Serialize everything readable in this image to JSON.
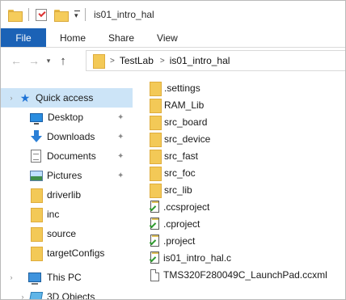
{
  "window": {
    "title": "is01_intro_hal"
  },
  "ribbon": {
    "tabs": [
      "File",
      "Home",
      "Share",
      "View"
    ]
  },
  "address": {
    "crumbs": [
      "TestLab",
      "is01_intro_hal"
    ]
  },
  "nav_pane": {
    "quick_access_label": "Quick access",
    "pinned": [
      {
        "label": "Desktop",
        "icon": "desktop-icon"
      },
      {
        "label": "Downloads",
        "icon": "download-icon"
      },
      {
        "label": "Documents",
        "icon": "documents-icon"
      },
      {
        "label": "Pictures",
        "icon": "pictures-icon"
      }
    ],
    "recent_folders": [
      "driverlib",
      "inc",
      "source",
      "targetConfigs"
    ],
    "this_pc_label": "This PC",
    "objects_label": "3D Objects"
  },
  "files": [
    {
      "name": ".settings",
      "type": "folder"
    },
    {
      "name": "RAM_Lib",
      "type": "folder"
    },
    {
      "name": "src_board",
      "type": "folder"
    },
    {
      "name": "src_device",
      "type": "folder"
    },
    {
      "name": "src_fast",
      "type": "folder"
    },
    {
      "name": "src_foc",
      "type": "folder"
    },
    {
      "name": "src_lib",
      "type": "folder"
    },
    {
      "name": ".ccsproject",
      "type": "editable-file"
    },
    {
      "name": ".cproject",
      "type": "editable-file"
    },
    {
      "name": ".project",
      "type": "editable-file"
    },
    {
      "name": "is01_intro_hal.c",
      "type": "editable-file"
    },
    {
      "name": "TMS320F280049C_LaunchPad.ccxml",
      "type": "plain-file"
    }
  ],
  "colors": {
    "accent": "#1b62b6",
    "selected": "#cce4f7",
    "folder": "#f5cc5b"
  }
}
